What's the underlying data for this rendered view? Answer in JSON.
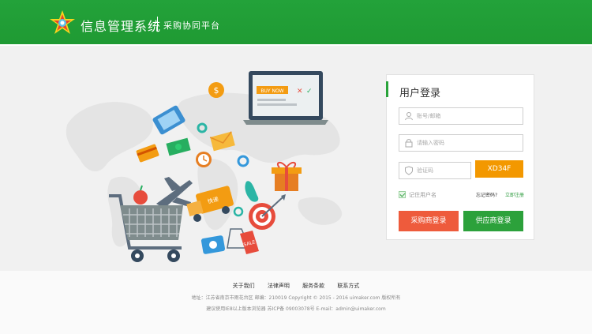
{
  "header": {
    "brand": "信息管理系统",
    "subtitle": "采购协同平台",
    "colors": {
      "primary": "#23a23a"
    }
  },
  "illustration": {
    "laptop_button": "BUY NOW",
    "van_label": "快递",
    "tag_label": "SALE"
  },
  "login": {
    "title": "用户登录",
    "username_placeholder": "账号/邮箱",
    "password_placeholder": "请输入密码",
    "captcha_placeholder": "验证码",
    "captcha_code": "XD34F",
    "remember_label": "记住用户名",
    "forgot_link": "忘记密码?",
    "register_link": "立即注册",
    "buyer_button": "采购商登录",
    "supplier_button": "供应商登录",
    "colors": {
      "buyer": "#ee5b3c",
      "supplier": "#2ca13b",
      "captcha": "#f39800"
    }
  },
  "footer": {
    "links": [
      "关于我们",
      "法律声明",
      "服务条款",
      "联系方式"
    ],
    "line1": "地址：江苏省南京市雨花台区   邮编：210019   Copyright © 2015 - 2016  uimaker.com 版权所有",
    "line2": "建议使用IE8以上版本浏览器   苏ICP备 09003078号   E-mail：admin@uimaker.com"
  }
}
